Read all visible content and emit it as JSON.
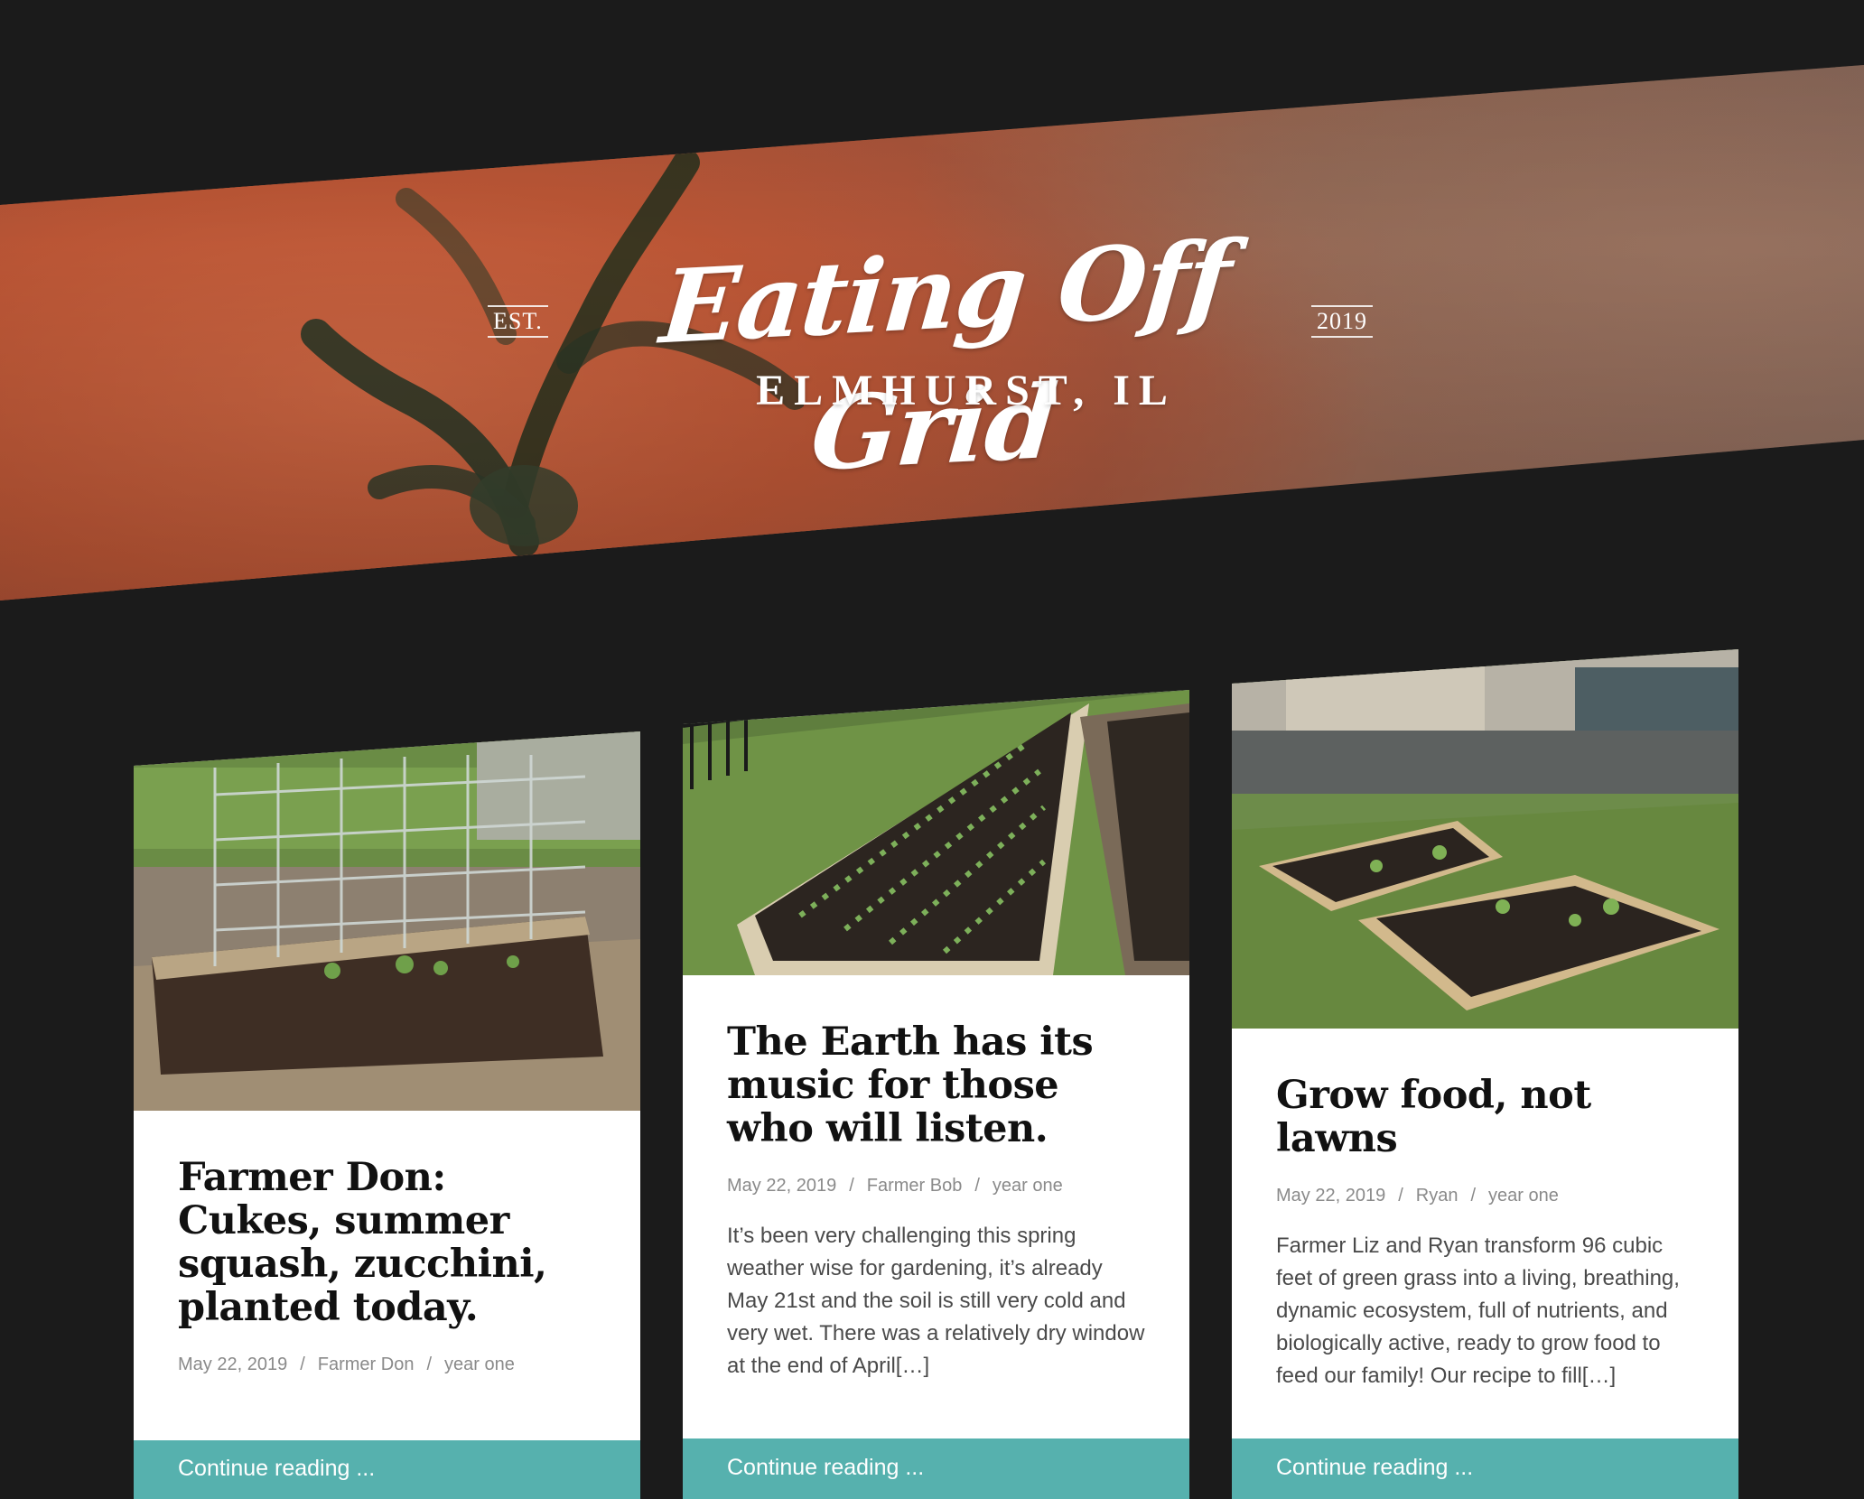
{
  "site": {
    "est_label": "EST.",
    "title": "Eating Off Grid",
    "year_label": "2019",
    "location": "ELMHURST, IL"
  },
  "posts": [
    {
      "title": "Farmer Don: Cukes, summer squash, zucchini, planted today.",
      "date": "May 22, 2019",
      "author": "Farmer Don",
      "category": "year one",
      "excerpt": "",
      "cta": "Continue reading ...",
      "image_desc": "raised garden bed with wire trellis"
    },
    {
      "title": "The Earth has its music for those who will listen.",
      "date": "May 22, 2019",
      "author": "Farmer Bob",
      "category": "year one",
      "excerpt": "It’s been very challenging this spring weather wise for gardening, it’s already May 21st and the soil is still very cold and very wet. There was a relatively dry window at the end of April[…]",
      "cta": "Continue reading ...",
      "image_desc": "long raised beds with seedling rows"
    },
    {
      "title": "Grow food, not lawns",
      "date": "May 22, 2019",
      "author": "Ryan",
      "category": "year one",
      "excerpt": "Farmer Liz and Ryan transform 96 cubic feet of green grass into a living, breathing, dynamic ecosystem, full of nutrients, and biologically active, ready to grow food to feed our family! Our recipe to fill[…]",
      "cta": "Continue reading ...",
      "image_desc": "L-shaped raised beds in a yard"
    }
  ],
  "meta_separator": "/",
  "colors": {
    "page_bg": "#1b1b1b",
    "cta_bg": "#56b1ae",
    "card_bg": "#ffffff",
    "title_text": "#111111",
    "meta_text": "#8a8a8a"
  }
}
